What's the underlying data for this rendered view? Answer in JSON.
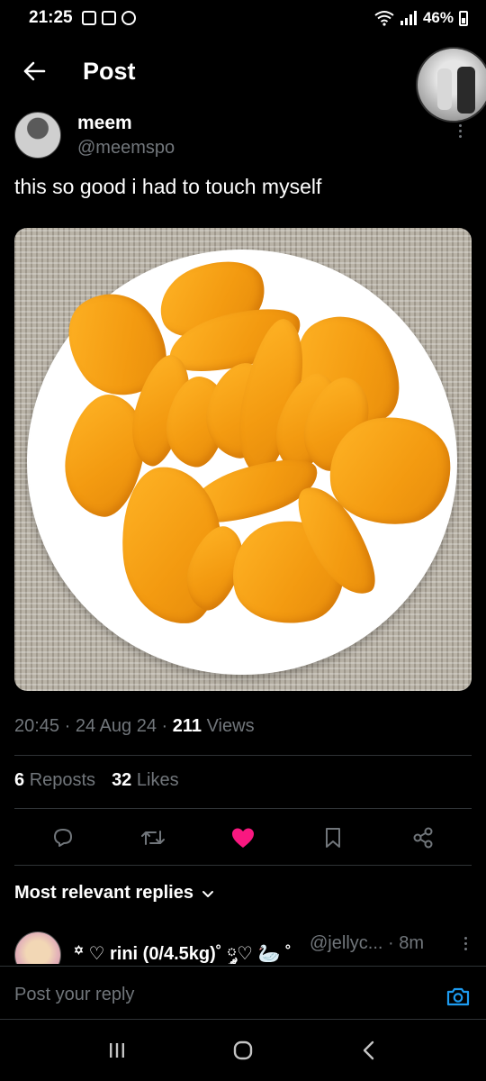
{
  "status_bar": {
    "time": "21:25",
    "battery": "46%",
    "icons": [
      "gallery-icon",
      "checkbox-icon",
      "messenger-icon",
      "wifi-icon",
      "signal-icon",
      "battery-icon"
    ]
  },
  "header": {
    "title": "Post"
  },
  "post": {
    "author_name": "meem",
    "author_handle": "@meemspo",
    "text": "this so good i had to touch myself",
    "time": "20:45",
    "date": "24 Aug 24",
    "views_count": "211",
    "views_label": "Views",
    "separator": "·",
    "reposts_count": "6",
    "reposts_label": "Reposts",
    "likes_count": "32",
    "likes_label": "Likes",
    "liked": true
  },
  "colors": {
    "background": "#000000",
    "text": "#e7e9ea",
    "muted": "#71767b",
    "divider": "#2f3336",
    "like": "#f91880",
    "accent": "#1d9bf0"
  },
  "replies": {
    "sort_label": "Most relevant replies",
    "items": [
      {
        "name": "꙳ ♡ rini (0/4.5kg)˚ ༘♡ 🦢 ˚",
        "handle": "@jellyc...",
        "time": "· 8m"
      }
    ]
  },
  "reply_input": {
    "placeholder": "Post your reply"
  }
}
